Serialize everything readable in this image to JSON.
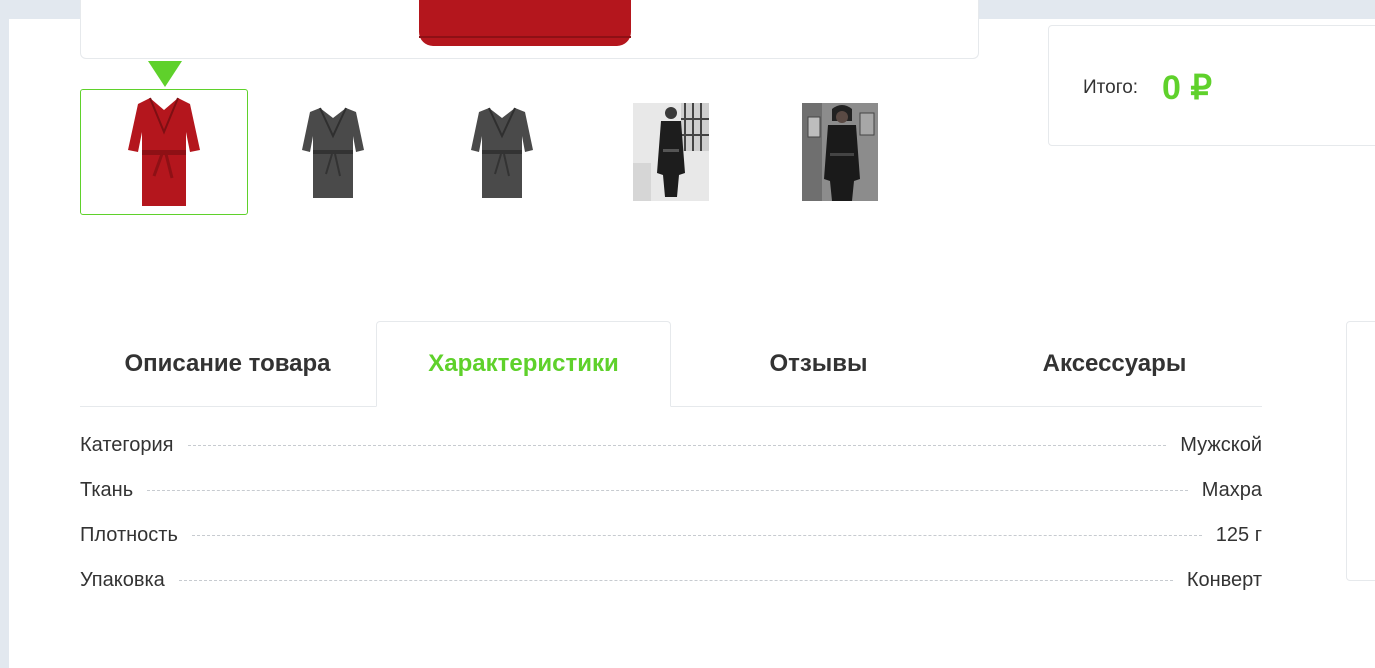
{
  "summary": {
    "label": "Итого:",
    "value": "0 ₽"
  },
  "gallery": {
    "thumbnails": [
      {
        "name": "thumb-red-robe",
        "active": true
      },
      {
        "name": "thumb-gray-robe-1",
        "active": false
      },
      {
        "name": "thumb-gray-robe-2",
        "active": false
      },
      {
        "name": "thumb-photo-man-1",
        "active": false
      },
      {
        "name": "thumb-photo-man-2",
        "active": false
      }
    ],
    "colors": {
      "accent": "#5fd12b",
      "robe_red": "#b4161d",
      "robe_gray": "#4a4a4a"
    }
  },
  "tabs": [
    {
      "label": "Описание товара",
      "active": false
    },
    {
      "label": "Характеристики",
      "active": true
    },
    {
      "label": "Отзывы",
      "active": false
    },
    {
      "label": "Аксессуары",
      "active": false
    }
  ],
  "specs": [
    {
      "name": "Категория",
      "value": "Мужской"
    },
    {
      "name": "Ткань",
      "value": "Махра"
    },
    {
      "name": "Плотность",
      "value": "125 г"
    },
    {
      "name": "Упаковка",
      "value": "Конверт"
    }
  ]
}
